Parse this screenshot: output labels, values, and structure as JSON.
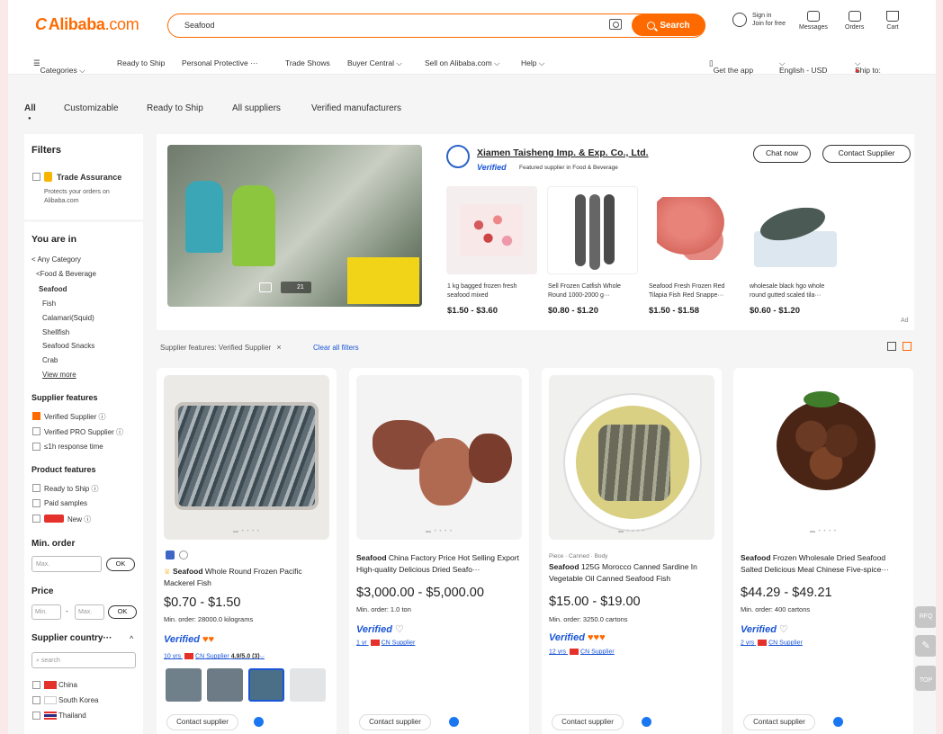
{
  "header": {
    "logo_mark": "C",
    "logo_brand": "Alibaba",
    "logo_domain": ".com",
    "search_value": "Seafood",
    "search_button": "Search",
    "signin": "Sign in",
    "join": "Join for free",
    "messages": "Messages",
    "orders": "Orders",
    "cart": "Cart"
  },
  "nav": {
    "items": [
      "Categories ⌵",
      "Ready to Ship",
      "Personal Protective ···",
      "Trade Shows",
      "Buyer Central ⌵",
      "Sell on Alibaba.com ⌵",
      "Help ⌵"
    ],
    "get_app": "Get the app",
    "language": "English - USD",
    "ship_to": "Ship to:"
  },
  "tabs": [
    "All",
    "Customizable",
    "Ready to Ship",
    "All suppliers",
    "Verified manufacturers"
  ],
  "filters": {
    "title": "Filters",
    "trade_assurance": "Trade Assurance",
    "trade_note": "Protects your orders on Alibaba.com",
    "you_are_in": "You are in",
    "crumbs": [
      "< Any Category",
      "<Food & Beverage",
      "Seafood"
    ],
    "subcats": [
      "Fish",
      "Calamari(Squid)",
      "Shellfish",
      "Seafood Snacks",
      "Crab"
    ],
    "view_more": "View more",
    "supplier_features": "Supplier features",
    "sf_items": [
      "Verified Supplier ⓘ",
      "Verified PRO Supplier ⓘ",
      "≤1h response time"
    ],
    "product_features": "Product features",
    "pf_items": [
      "Ready to Ship ⓘ",
      "Paid samples",
      "New ⓘ"
    ],
    "min_order": "Min. order",
    "max_placeholder": "Max.",
    "ok": "OK",
    "price": "Price",
    "min_placeholder": "Min.",
    "country_title": "Supplier country···",
    "country_search": "search",
    "countries": [
      "China",
      "South Korea",
      "Thailand"
    ]
  },
  "ad": {
    "company": "Xiamen Taisheng Imp. & Exp. Co., Ltd.",
    "verified": "Verified",
    "featured": "Featured supplier in Food & Beverage",
    "chat_now": "Chat now",
    "contact": "Contact Supplier",
    "video_count": "21",
    "ad_label": "Ad",
    "products": [
      {
        "title": "1 kg bagged frozen fresh seafood mixed",
        "price": "$1.50 - $3.60"
      },
      {
        "title": "Sell Frozen Catfish Whole Round 1000-2000 g···",
        "price": "$0.80 - $1.20"
      },
      {
        "title": "Seafood Fresh Frozen Red Tilapia Fish Red Snappe···",
        "price": "$1.50 - $1.58"
      },
      {
        "title": "wholesale black hgo whole round gutted scaled tila···",
        "price": "$0.60 - $1.20"
      }
    ]
  },
  "applied": {
    "chip": "Supplier features: Verified Supplier",
    "clear": "Clear all filters"
  },
  "cards": [
    {
      "tag": "",
      "title_b": "Seafood",
      "title": " Whole Round Frozen Pacific Mackerel Fish",
      "price": "$0.70 - $1.50",
      "min": "Min. order: 28000.0 kilograms",
      "years": "10 yrs",
      "country": "CN Supplier",
      "rating": "4.9/5.0 (3)",
      "contact": "Contact supplier"
    },
    {
      "tag": "",
      "title_b": "Seafood",
      "title": " China Factory Price Hot Selling Export High-quality Delicious Dried Seafo···",
      "price": "$3,000.00 - $5,000.00",
      "min": "Min. order: 1.0 ton",
      "years": "1 yr",
      "country": "CN Supplier",
      "rating": "",
      "contact": "Contact supplier"
    },
    {
      "tag": "Piece · Canned · Body",
      "title_b": "Seafood",
      "title": " 125G Morocco Canned Sardine In Vegetable Oil Canned Seafood Fish",
      "price": "$15.00 - $19.00",
      "min": "Min. order: 3250.0 cartons",
      "years": "12 yrs",
      "country": "CN Supplier",
      "rating": "",
      "contact": "Contact supplier"
    },
    {
      "tag": "",
      "title_b": "Seafood",
      "title": " Frozen Wholesale Dried Seafood Salted Delicious Meal Chinese Five-spice···",
      "price": "$44.29 - $49.21",
      "min": "Min. order: 400 cartons",
      "years": "2 yrs",
      "country": "CN Supplier",
      "rating": "",
      "contact": "Contact supplier"
    }
  ],
  "fab": [
    "RFQ",
    "✎",
    "TOP"
  ]
}
